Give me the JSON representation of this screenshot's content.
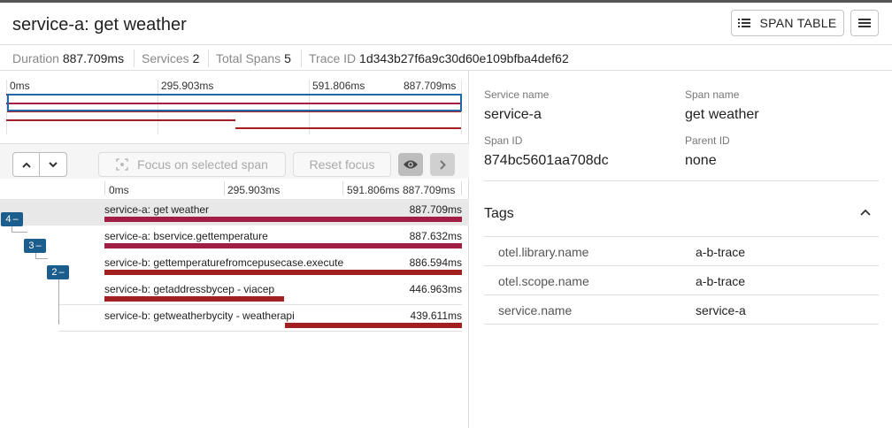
{
  "header": {
    "title": "service-a: get weather",
    "span_table_label": "SPAN TABLE"
  },
  "stats": {
    "duration_label": "Duration",
    "duration_value": "887.709ms",
    "services_label": "Services",
    "services_value": "2",
    "spans_label": "Total Spans",
    "spans_value": "5",
    "trace_label": "Trace ID",
    "trace_value": "1d343b27f6a9c30d60e109bfba4def62"
  },
  "timeline": {
    "ticks": [
      "0ms",
      "295.903ms",
      "591.806ms",
      "887.709ms"
    ]
  },
  "controls": {
    "focus_label": "Focus on selected span",
    "reset_label": "Reset focus"
  },
  "spans": [
    {
      "label": "service-a: get weather",
      "duration": "887.709ms",
      "start_fraction": 0.0,
      "duration_fraction": 1.0,
      "color": "#a21f44",
      "badge": "4",
      "selected": true
    },
    {
      "label": "service-a: bservice.gettemperature",
      "duration": "887.632ms",
      "start_fraction": 0.0,
      "duration_fraction": 1.0,
      "color": "#a21f44",
      "badge": "3",
      "selected": false
    },
    {
      "label": "service-b: gettemperaturefromcepusecase.execute",
      "duration": "886.594ms",
      "start_fraction": 0.001,
      "duration_fraction": 0.999,
      "color": "#a32020",
      "badge": "2",
      "selected": false
    },
    {
      "label": "service-b: getaddressbycep - viacep",
      "duration": "446.963ms",
      "start_fraction": 0.0,
      "duration_fraction": 0.5035,
      "color": "#a32020",
      "badge": "",
      "selected": false
    },
    {
      "label": "service-b: getweatherbycity - weatherapi",
      "duration": "439.611ms",
      "start_fraction": 0.5045,
      "duration_fraction": 0.4952,
      "color": "#a32020",
      "badge": "",
      "selected": false
    }
  ],
  "detail": {
    "service_name_label": "Service name",
    "service_name": "service-a",
    "span_name_label": "Span name",
    "span_name": "get weather",
    "span_id_label": "Span ID",
    "span_id": "874bc5601aa708dc",
    "parent_id_label": "Parent ID",
    "parent_id": "none",
    "tags_title": "Tags",
    "tags": [
      {
        "key": "otel.library.name",
        "value": "a-b-trace"
      },
      {
        "key": "otel.scope.name",
        "value": "a-b-trace"
      },
      {
        "key": "service.name",
        "value": "service-a"
      }
    ]
  },
  "colors": {
    "service_a": "#a21f44",
    "service_b": "#a32020",
    "badge": "#1b5e8d",
    "selection": "#2367a6"
  }
}
